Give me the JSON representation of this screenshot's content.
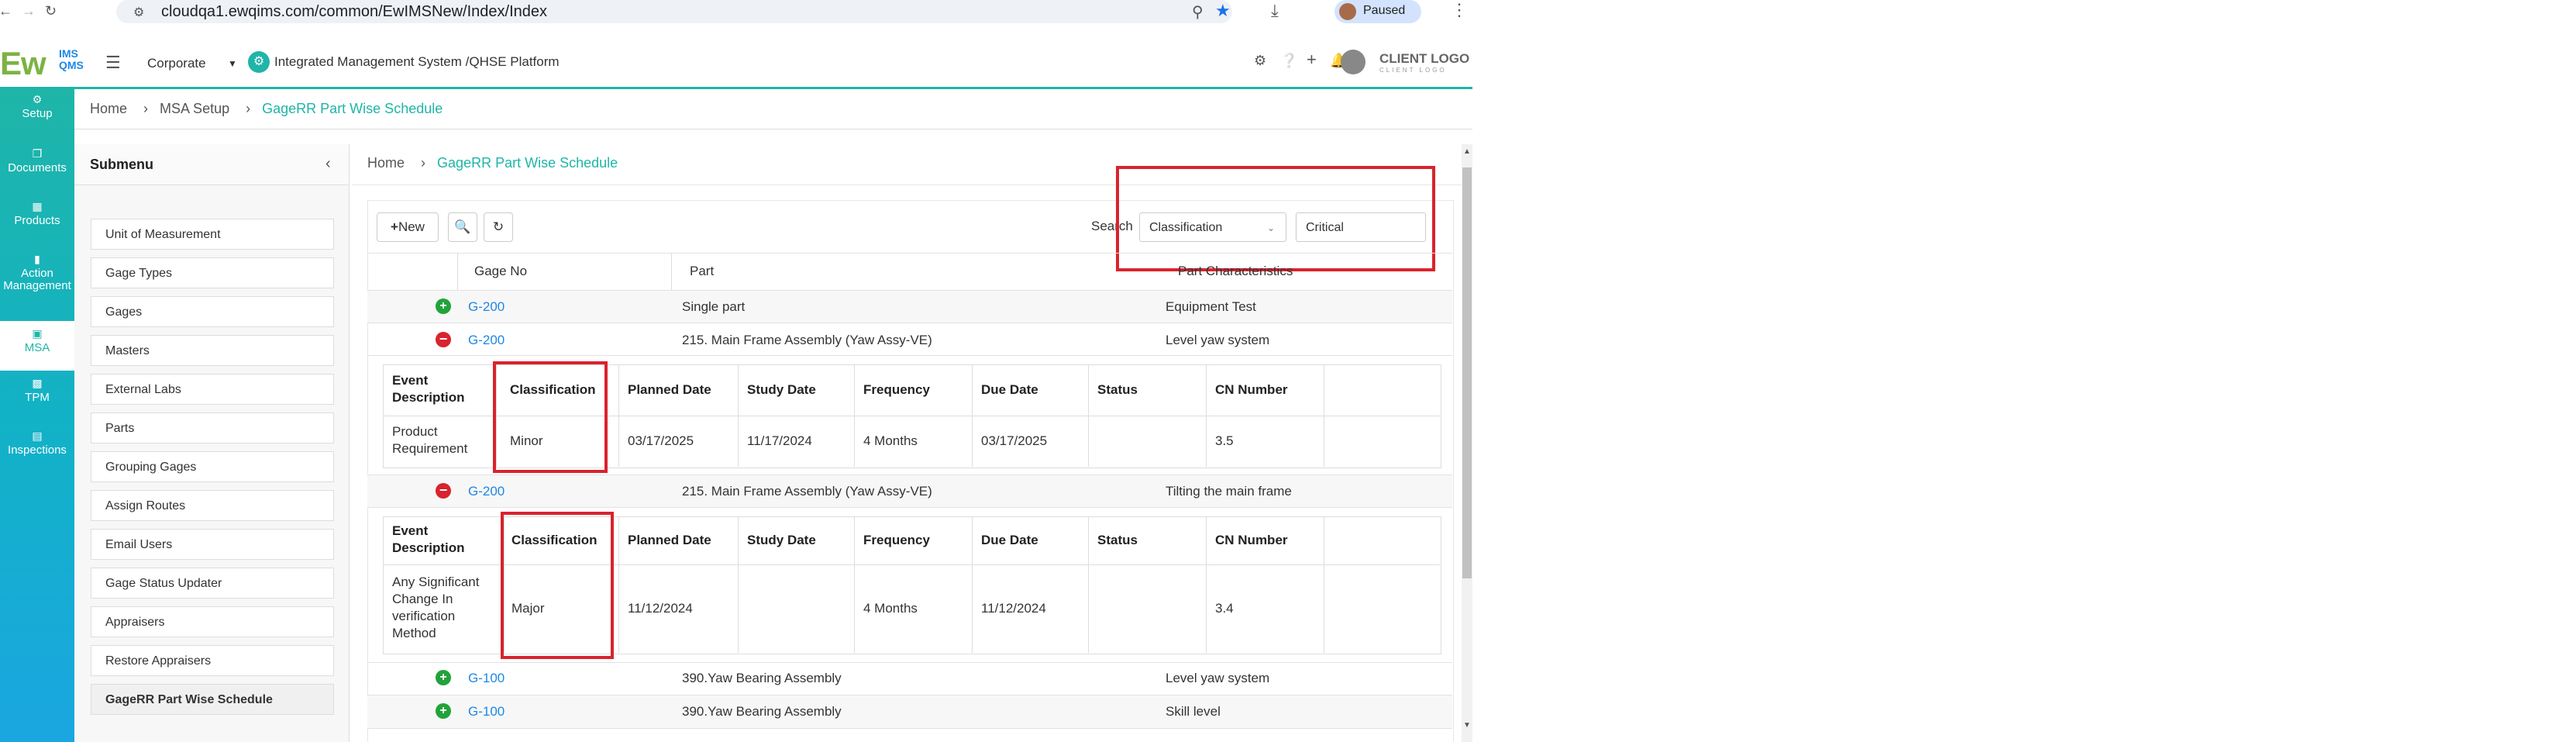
{
  "browser": {
    "url": "cloudqa1.ewqims.com/common/EwIMSNew/Index/Index",
    "profile_status": "Paused"
  },
  "header": {
    "logo_main": "Ew",
    "logo_sub1": "IMS",
    "logo_sub2": "QMS",
    "entity": "Corporate",
    "platform": "Integrated Management System /QHSE Platform",
    "client_logo": "CLIENT LOGO",
    "client_tag": "CLIENT LOGO"
  },
  "sidebar": {
    "items": [
      {
        "label": "Setup"
      },
      {
        "label": "Documents"
      },
      {
        "label": "Products"
      },
      {
        "label": "Action Management"
      },
      {
        "label": "MSA"
      },
      {
        "label": "TPM"
      },
      {
        "label": "Inspections"
      }
    ]
  },
  "breadcrumb_top": {
    "home": "Home",
    "mid": "MSA Setup",
    "current": "GageRR Part Wise Schedule"
  },
  "submenu": {
    "title": "Submenu",
    "items": [
      "Unit of Measurement",
      "Gage Types",
      "Gages",
      "Masters",
      "External Labs",
      "Parts",
      "Grouping Gages",
      "Assign Routes",
      "Email Users",
      "Gage Status Updater",
      "Appraisers",
      "Restore Appraisers",
      "GageRR Part Wise Schedule"
    ]
  },
  "breadcrumb_inner": {
    "home": "Home",
    "current": "GageRR Part Wise Schedule"
  },
  "toolbar": {
    "new_label": "New",
    "search_label": "Search",
    "search_field": "Classification",
    "search_value": "Critical"
  },
  "table": {
    "headers": [
      "Gage No",
      "Part",
      "Part Characteristics"
    ],
    "rows": [
      {
        "gage": "G-200",
        "part": "Single part",
        "char": "Equipment Test",
        "state": "collapsed"
      },
      {
        "gage": "G-200",
        "part": "215. Main Frame Assembly (Yaw Assy-VE)",
        "char": "Level yaw system",
        "state": "expanded"
      },
      {
        "gage": "G-200",
        "part": "215. Main Frame Assembly (Yaw Assy-VE)",
        "char": "Tilting the main frame",
        "state": "expanded"
      },
      {
        "gage": "G-100",
        "part": "390.Yaw Bearing Assembly",
        "char": "Level yaw system",
        "state": "collapsed"
      },
      {
        "gage": "G-100",
        "part": "390.Yaw Bearing Assembly",
        "char": "Skill level",
        "state": "collapsed"
      }
    ]
  },
  "subtable": {
    "headers": [
      "Event Description",
      "Classification",
      "Planned Date",
      "Study Date",
      "Frequency",
      "Due Date",
      "Status",
      "CN Number"
    ],
    "rows": [
      {
        "event": "Product Requirement",
        "classification": "Minor",
        "planned": "03/17/2025",
        "study": "11/17/2024",
        "frequency": "4 Months",
        "due": "03/17/2025",
        "status": "",
        "cn": "3.5"
      },
      {
        "event": "Any Significant Change In verification Method",
        "classification": "Major",
        "planned": "11/12/2024",
        "study": "",
        "frequency": "4 Months",
        "due": "11/12/2024",
        "status": "",
        "cn": "3.4"
      }
    ]
  },
  "colors": {
    "accent": "#1fb5a8",
    "link": "#1e88e5",
    "highlight": "#d9232d",
    "add": "#22a33a"
  }
}
